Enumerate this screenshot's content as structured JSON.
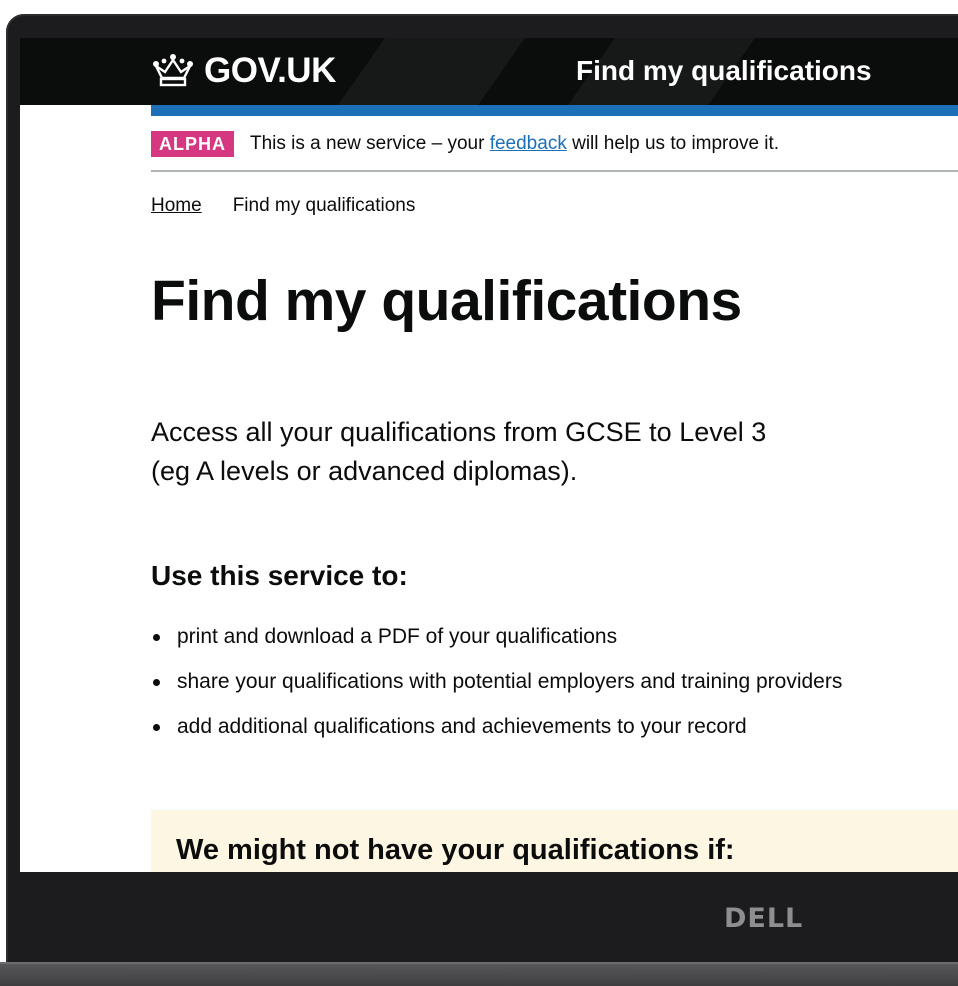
{
  "header": {
    "logo": "GOV.UK",
    "service_name": "Find my qualifications"
  },
  "phase_banner": {
    "tag": "ALPHA",
    "text_before": "This is a new service – your ",
    "link": "feedback",
    "text_after": " will help us to improve it."
  },
  "breadcrumb": {
    "items": [
      "Home",
      "Find my qualifications"
    ]
  },
  "main": {
    "title": "Find my qualifications",
    "intro_line1": "Access all your qualifications from GCSE to Level 3",
    "intro_line2": "(eg A levels or advanced diplomas).",
    "subheading": "Use this service to:",
    "bullets": [
      "print and download a PDF of your qualifications",
      "share your qualifications with potential employers and training providers",
      "add additional qualifications and achievements to your record"
    ],
    "notice_title": "We might not have your qualifications if:"
  },
  "device": {
    "brand": "DELL"
  },
  "colors": {
    "header_bg": "#0b0c0c",
    "header_bar": "#1d70b8",
    "phase_tag": "#d53880",
    "link": "#1d70b8",
    "notice_bg": "#fdf6e3"
  }
}
